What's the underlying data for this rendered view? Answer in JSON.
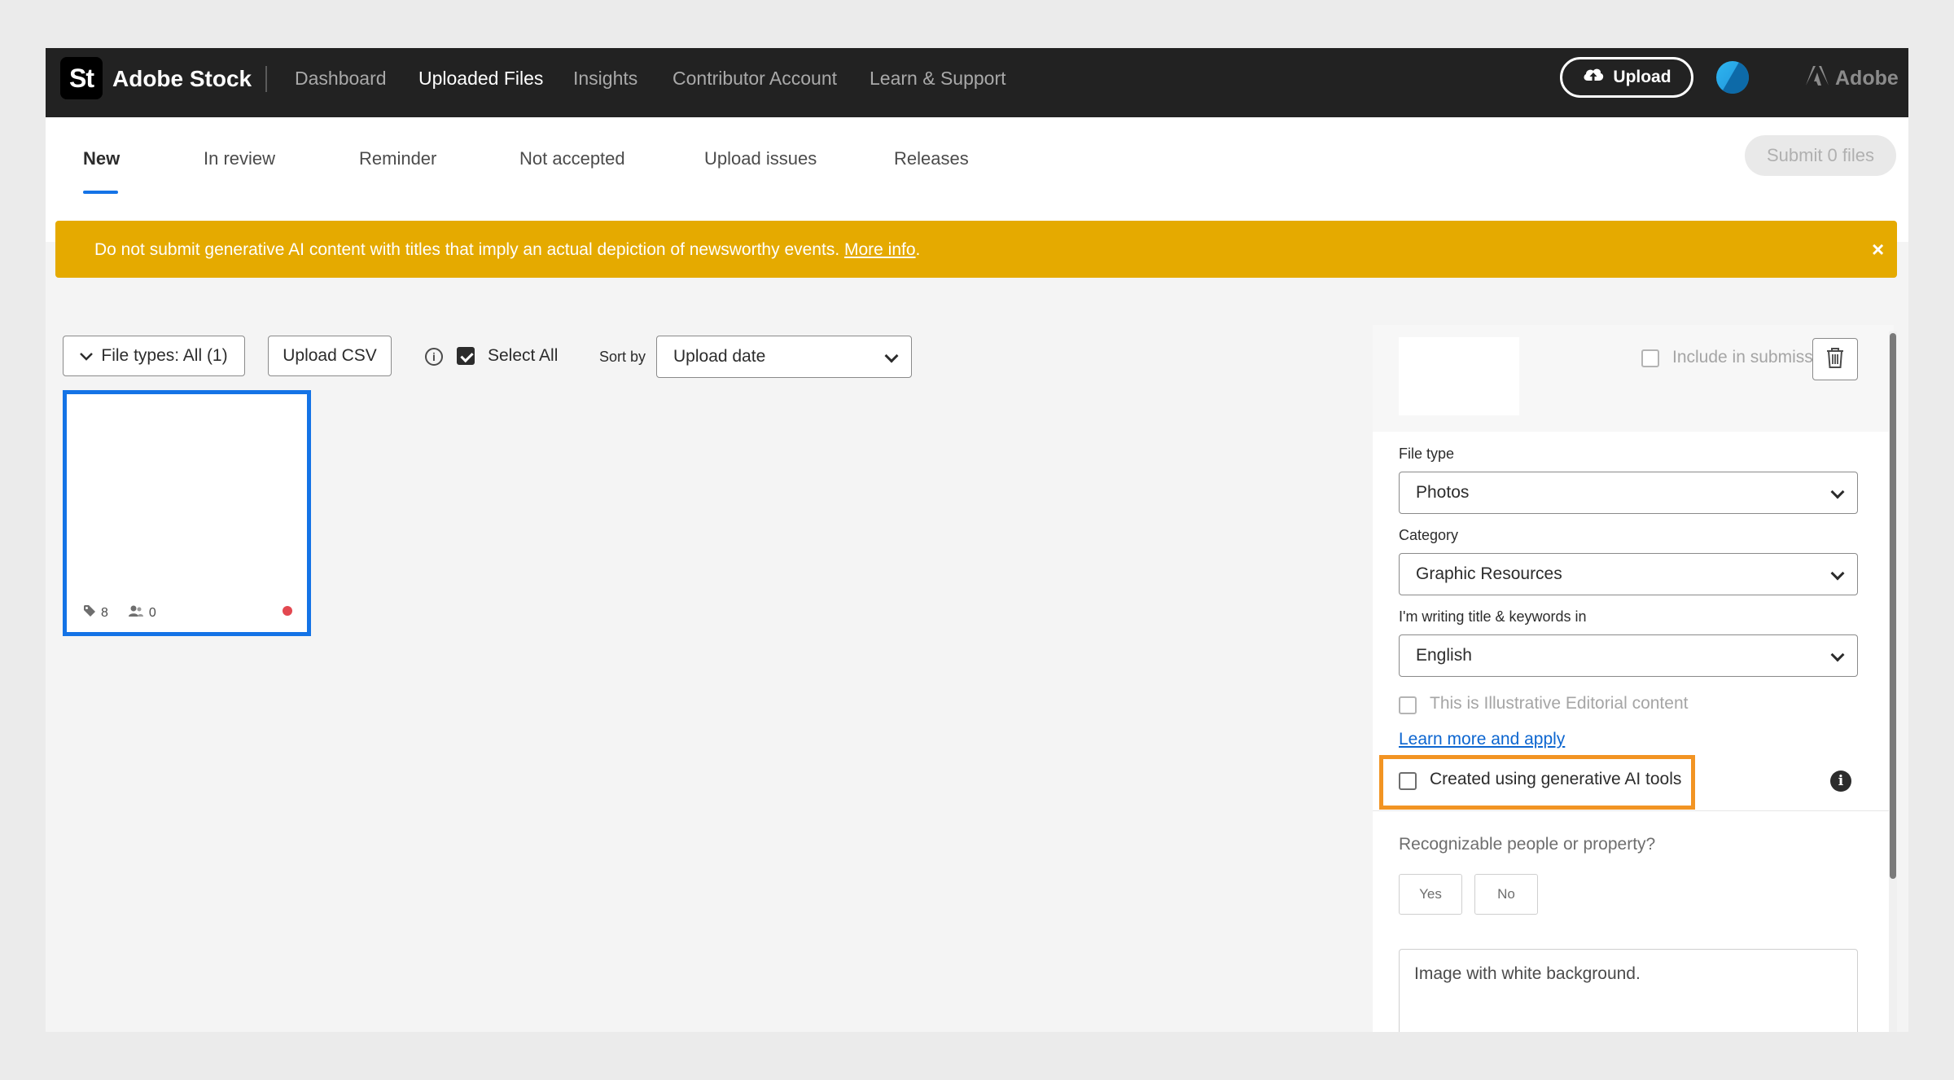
{
  "header": {
    "logo_text": "St",
    "brand": "Adobe Stock",
    "nav": [
      "Dashboard",
      "Uploaded Files",
      "Insights",
      "Contributor Account",
      "Learn & Support"
    ],
    "upload_label": "Upload",
    "adobe_label": "Adobe"
  },
  "tabs": [
    "New",
    "In review",
    "Reminder",
    "Not accepted",
    "Upload issues",
    "Releases"
  ],
  "submit_label": "Submit 0 files",
  "banner": {
    "text": "Do not submit generative AI content with titles that imply an actual depiction of newsworthy events.",
    "link": "More info",
    "period": ".",
    "close": "×"
  },
  "toolbar": {
    "file_types": "File types: All (1)",
    "upload_csv": "Upload CSV",
    "select_all": "Select All",
    "sort_by": "Sort by",
    "sort_value": "Upload date"
  },
  "thumbnail": {
    "keywords_count": "8",
    "people_count": "0"
  },
  "panel": {
    "include_label": "Include in submission",
    "file_type_label": "File type",
    "file_type_value": "Photos",
    "category_label": "Category",
    "category_value": "Graphic Resources",
    "language_label": "I'm writing title & keywords in",
    "language_value": "English",
    "editorial_label": "This is Illustrative Editorial content",
    "learn_more": "Learn more and apply",
    "gen_ai_label": "Created using generative AI tools",
    "people_question": "Recognizable people or property?",
    "yes": "Yes",
    "no": "No",
    "title_value": "Image with white background."
  },
  "colors": {
    "accent": "#1473e6",
    "banner": "#e5aa00",
    "highlight": "#f29423",
    "topbar": "#222222"
  }
}
